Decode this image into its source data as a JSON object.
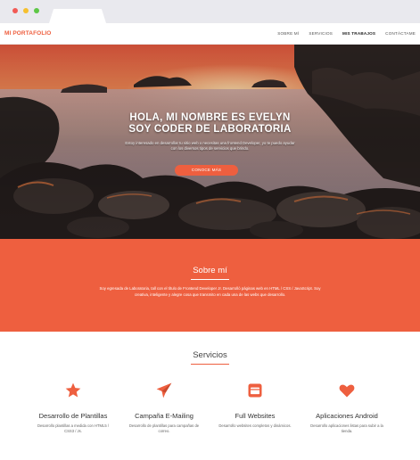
{
  "header": {
    "logo": "MI PORTAFOLIO",
    "nav": [
      "SOBRE MÍ",
      "SERVICIOS",
      "MIS TRABAJOS",
      "CONTÁCTAME"
    ]
  },
  "hero": {
    "title_line1": "HOLA, MI NOMBRE ES EVELYN",
    "title_line2": "SOY CODER DE LABORATORIA",
    "text": "Estoy interesado en desarrollar tu sitio web o necesitas una frontend Developer, yo te puedo ayudar con los diversos tipos de servicios que brindo.",
    "button": "CONOCE MÁS"
  },
  "about": {
    "title": "Sobre mí",
    "text": "Soy egresada de Laboratoria, tall con el título de Frontend Developer Jr. Desarrolló páginas web en HTML / CSS / JavaScript. Soy creativa, inteligente y alegre cosa que transmito en cada una de las webs que desarrollo."
  },
  "services": {
    "title": "Servicios",
    "items": [
      {
        "icon": "star-icon",
        "name": "Desarrollo de Plantillas",
        "desc": "Desarrollo plantillas a medida con HTML5 / CSS3 / Js."
      },
      {
        "icon": "paper-plane-icon",
        "name": "Campaña E-Mailing",
        "desc": "Desarrollo de plantillas para campañas de correo."
      },
      {
        "icon": "browser-window-icon",
        "name": "Full Websites",
        "desc": "Desarrollo websites completos y dinámicos."
      },
      {
        "icon": "heart-icon",
        "name": "Aplicaciones Android",
        "desc": "Desarrollo aplicaciones listas para subir a la tienda."
      }
    ]
  },
  "colors": {
    "accent": "#ee5f3f",
    "chrome": "#e9e9ee"
  }
}
